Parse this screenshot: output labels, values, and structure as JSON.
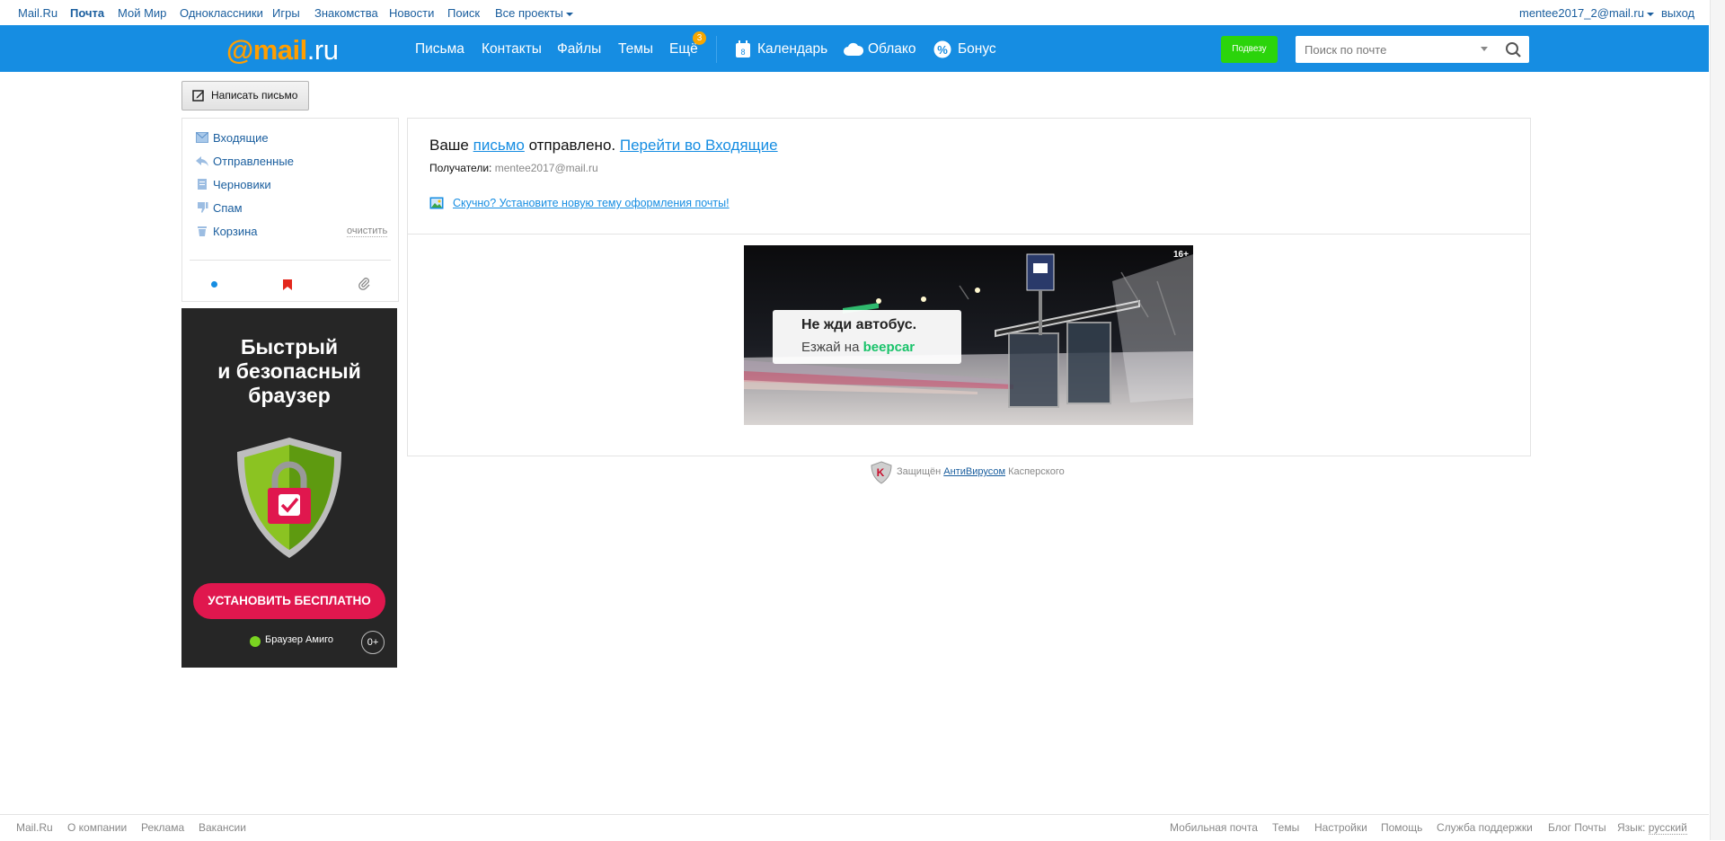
{
  "portal": {
    "links": [
      "Mail.Ru",
      "Почта",
      "Мой Мир",
      "Одноклассники",
      "Игры",
      "Знакомства",
      "Новости",
      "Поиск",
      "Все проекты"
    ],
    "user": "mentee2017_2@mail.ru",
    "logout": "выход"
  },
  "header": {
    "logo_at": "@",
    "logo_mail": "mail",
    "logo_dot": ".",
    "logo_ru": "ru",
    "nav": [
      "Письма",
      "Контакты",
      "Файлы",
      "Темы",
      "Ещё"
    ],
    "more_badge": "3",
    "calendar": "Календарь",
    "cloud": "Облако",
    "bonus": "Бонус",
    "podvezu": "Подвезу",
    "search_placeholder": "Поиск по почте"
  },
  "compose_label": "Написать письмо",
  "folders": {
    "items": [
      "Входящие",
      "Отправленные",
      "Черновики",
      "Спам",
      "Корзина"
    ],
    "clear": "очистить"
  },
  "sidead": {
    "headline_1": "Быстрый",
    "headline_2": "и безопасный",
    "headline_3": "браузер",
    "cta": "УСТАНОВИТЬ БЕСПЛАТНО",
    "brand": "Браузер Амиго",
    "age": "0+"
  },
  "main": {
    "msg_prefix": "Ваше",
    "msg_link": "письмо",
    "msg_mid": "отправлено.",
    "msg_inbox": "Перейти во Входящие",
    "recipients_label": "Получатели:",
    "recipients_value": "mentee2017@mail.ru",
    "theme_link": "Скучно? Установите новую тему оформления почты!"
  },
  "banner": {
    "line1": "Не жди автобус.",
    "line2_prefix": "Езжай на",
    "line2_brand": "beepcar",
    "age": "16+"
  },
  "kaspersky": {
    "prefix": "Защищён",
    "link": "АнтиВирусом",
    "suffix": "Касперского"
  },
  "footer": {
    "left": [
      "Mail.Ru",
      "О компании",
      "Реклама",
      "Вакансии"
    ],
    "right": [
      "Мобильная почта",
      "Темы",
      "Настройки",
      "Помощь",
      "Служба поддержки",
      "Блог Почты"
    ],
    "lang_label": "Язык:",
    "lang_value": "русский"
  },
  "colors": {
    "header_blue": "#168de2",
    "logo_orange": "#ff9e00",
    "podvezu_green": "#2bd40b",
    "cta_red": "#e0174e"
  }
}
